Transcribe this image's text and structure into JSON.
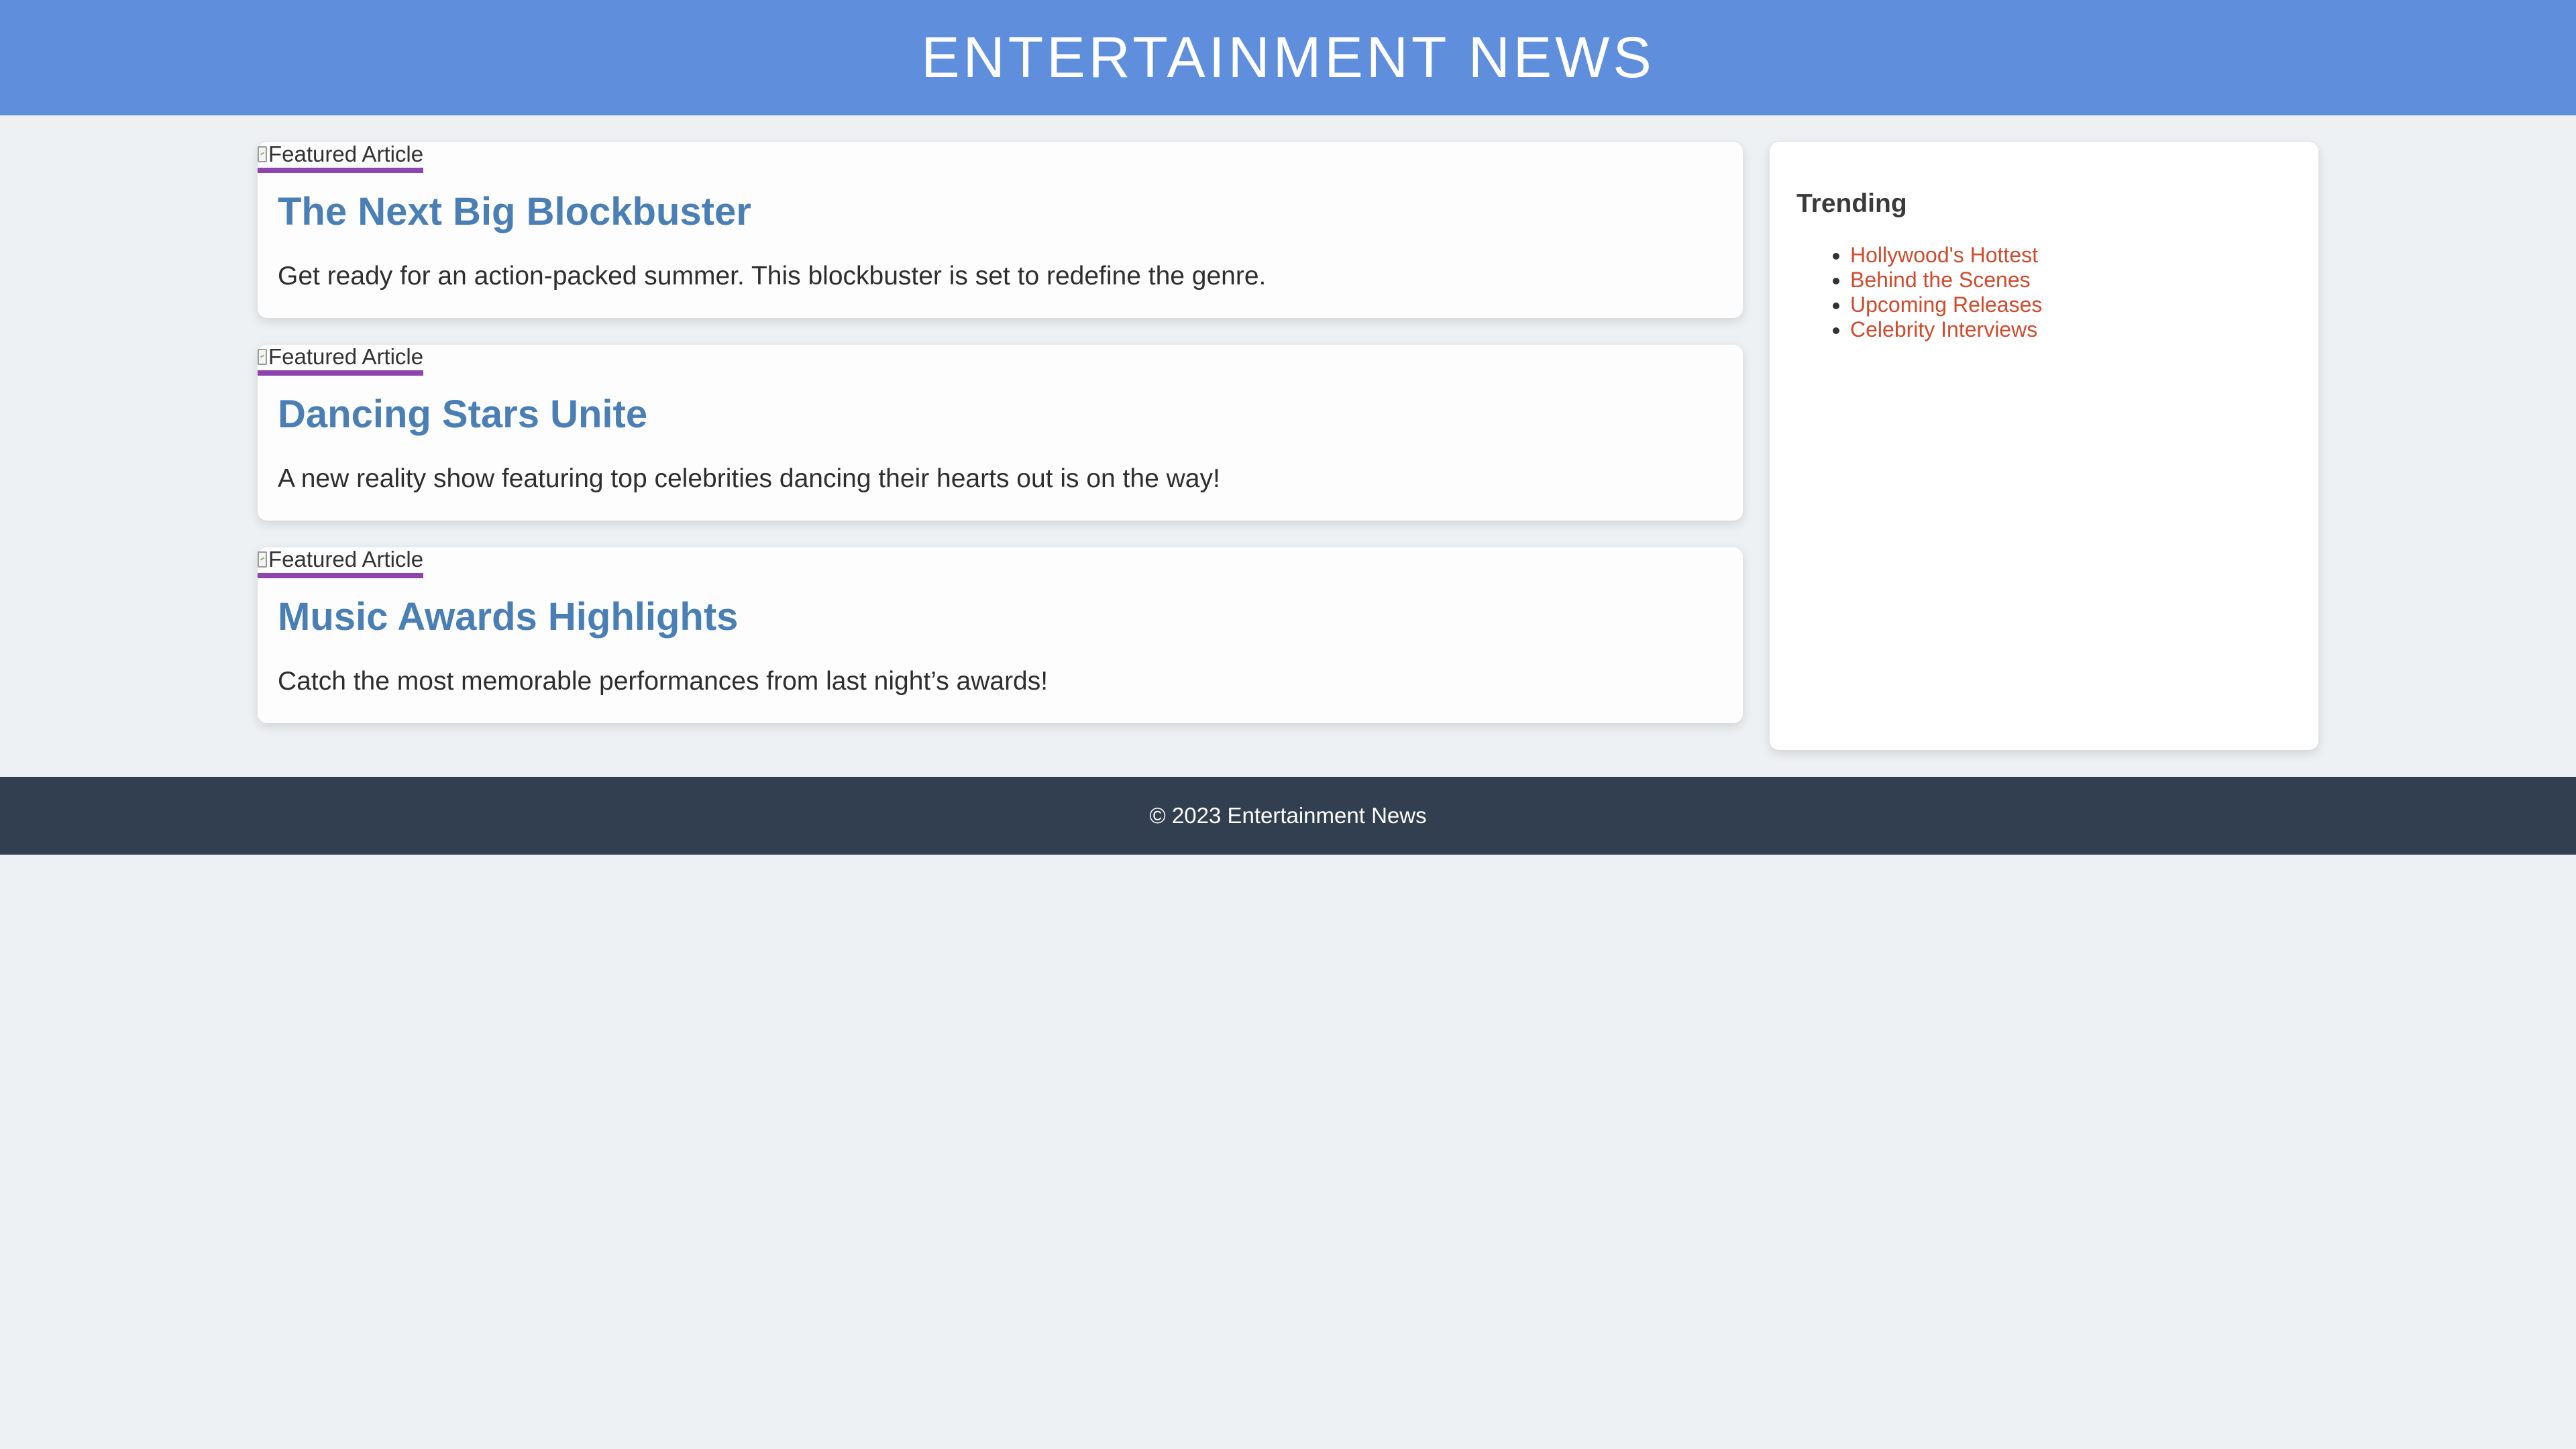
{
  "header": {
    "title": "ENTERTAINMENT NEWS"
  },
  "articles": [
    {
      "image_alt": "Featured Article",
      "title": "The Next Big Blockbuster",
      "summary": "Get ready for an action-packed summer. This blockbuster is set to redefine the genre."
    },
    {
      "image_alt": "Featured Article",
      "title": "Dancing Stars Unite",
      "summary": "A new reality show featuring top celebrities dancing their hearts out is on the way!"
    },
    {
      "image_alt": "Featured Article",
      "title": "Music Awards Highlights",
      "summary": "Catch the most memorable performances from last night’s awards!"
    }
  ],
  "sidebar": {
    "heading": "Trending",
    "links": [
      "Hollywood's Hottest",
      "Behind the Scenes",
      "Upcoming Releases",
      "Celebrity Interviews"
    ]
  },
  "footer": {
    "text": "© 2023 Entertainment News"
  },
  "colors": {
    "header_bg": "#5f8fdc",
    "article_title": "#4a7fb5",
    "image_underline": "#8e44ad",
    "trending_link": "#d04a2c",
    "footer_bg": "#323f51",
    "page_bg": "#eef1f3"
  }
}
